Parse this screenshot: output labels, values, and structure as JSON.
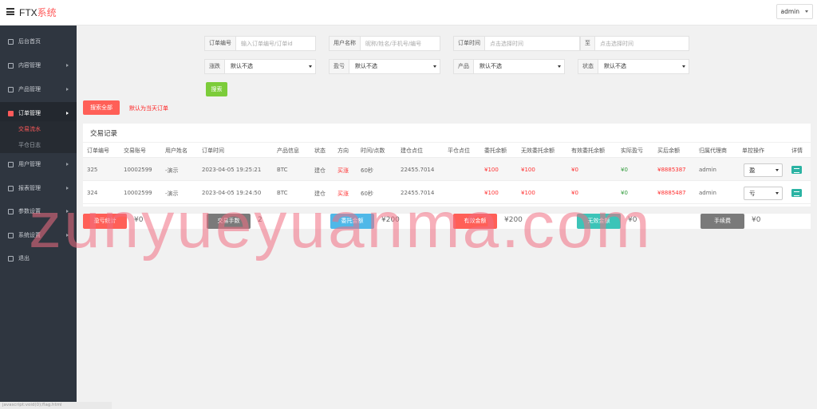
{
  "header": {
    "brand_prefix": "FTX",
    "brand_suffix": "系统",
    "user": "admin"
  },
  "sidebar": {
    "items": [
      {
        "label": "后台首页",
        "icon": "dashboard-icon"
      },
      {
        "label": "内容管理",
        "icon": "content-icon"
      },
      {
        "label": "产品管理",
        "icon": "product-icon"
      },
      {
        "label": "订单管理",
        "icon": "order-icon"
      },
      {
        "label": "用户管理",
        "icon": "user-icon"
      },
      {
        "label": "报表管理",
        "icon": "report-icon"
      },
      {
        "label": "参数设置",
        "icon": "settings-icon"
      },
      {
        "label": "系统设置",
        "icon": "system-icon"
      },
      {
        "label": "退出",
        "icon": "logout-icon"
      }
    ],
    "sub_items": [
      "交易流水",
      "平仓日志"
    ]
  },
  "filters": {
    "order_no": {
      "label": "订单编号",
      "placeholder": "输入订单编号/订单id"
    },
    "user_name": {
      "label": "用户名称",
      "placeholder": "昵称/姓名/手机号/编号"
    },
    "order_time": {
      "label": "订单时间",
      "placeholder": "点击选择时间"
    },
    "to": {
      "label": "至",
      "placeholder": "点击选择时间"
    },
    "rise_fall": {
      "label": "涨跌",
      "value": "默认不选"
    },
    "profit_loss": {
      "label": "盈亏",
      "value": "默认不选"
    },
    "product": {
      "label": "产品",
      "value": "默认不选"
    },
    "status": {
      "label": "状态",
      "value": "默认不选"
    },
    "search_label": "搜索",
    "search_all_label": "搜索全部",
    "default_hint": "默认为当天订单"
  },
  "table": {
    "title": "交易记录",
    "headers": [
      "订单编号",
      "交易账号",
      "用户姓名",
      "订单时间",
      "产品信息",
      "状态",
      "方向",
      "时间/点数",
      "建仓点位",
      "平仓点位",
      "委托余额",
      "无效委托余额",
      "有效委托余额",
      "实际盈亏",
      "买后余额",
      "归属代理商",
      "单控操作",
      "详情"
    ],
    "rows": [
      {
        "id": "325",
        "account": "10002599",
        "name": "-演示",
        "time": "2023-04-05 19:25:21",
        "product": "BTC",
        "status": "建仓",
        "direction": "买涨",
        "duration": "60秒",
        "open": "22455.7014",
        "close": "",
        "entrust": "¥100",
        "invalid": "¥100",
        "valid": "¥0",
        "pnl": "¥0",
        "balance": "¥8885387",
        "agent": "admin",
        "control": "盈"
      },
      {
        "id": "324",
        "account": "10002599",
        "name": "-演示",
        "time": "2023-04-05 19:24:50",
        "product": "BTC",
        "status": "建仓",
        "direction": "买涨",
        "duration": "60秒",
        "open": "22455.7014",
        "close": "",
        "entrust": "¥100",
        "invalid": "¥100",
        "valid": "¥0",
        "pnl": "¥0",
        "balance": "¥8885487",
        "agent": "admin",
        "control": "亏"
      }
    ]
  },
  "summary": [
    {
      "label": "盈亏统计",
      "value": "¥0",
      "color": "#ff5f57"
    },
    {
      "label": "交易手数",
      "value": "2",
      "color": "#7a7a7a"
    },
    {
      "label": "委托金额",
      "value": "¥200",
      "color": "#4fb8e8"
    },
    {
      "label": "有效金额",
      "value": "¥200",
      "color": "#ff5f57"
    },
    {
      "label": "无效金额",
      "value": "¥0",
      "color": "#3cc4b8"
    },
    {
      "label": "手续费",
      "value": "¥0",
      "color": "#7a7a7a"
    }
  ],
  "watermark": "zunyueyuanma.com",
  "statusbar": "javascript:void(0);flag.html"
}
